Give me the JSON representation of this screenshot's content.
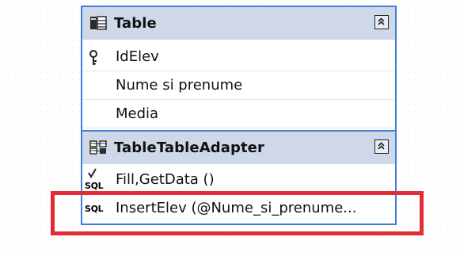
{
  "table": {
    "title": "Table",
    "columns": [
      {
        "label": "IdElev",
        "is_key": true
      },
      {
        "label": "Nume si prenume",
        "is_key": false
      },
      {
        "label": "Media",
        "is_key": false
      }
    ]
  },
  "adapter": {
    "title": "TableTableAdapter",
    "queries": [
      {
        "label": "Fill,GetData ()",
        "icon": "sql-checked-icon",
        "icon_text": "SQL"
      },
      {
        "label": "InsertElev (@Nume_si_prenume...",
        "icon": "sql-icon",
        "icon_text": "SQL"
      }
    ]
  },
  "colors": {
    "border": "#3c7fd6",
    "header_bg": "#cfd8e8",
    "highlight": "#e32c35"
  }
}
